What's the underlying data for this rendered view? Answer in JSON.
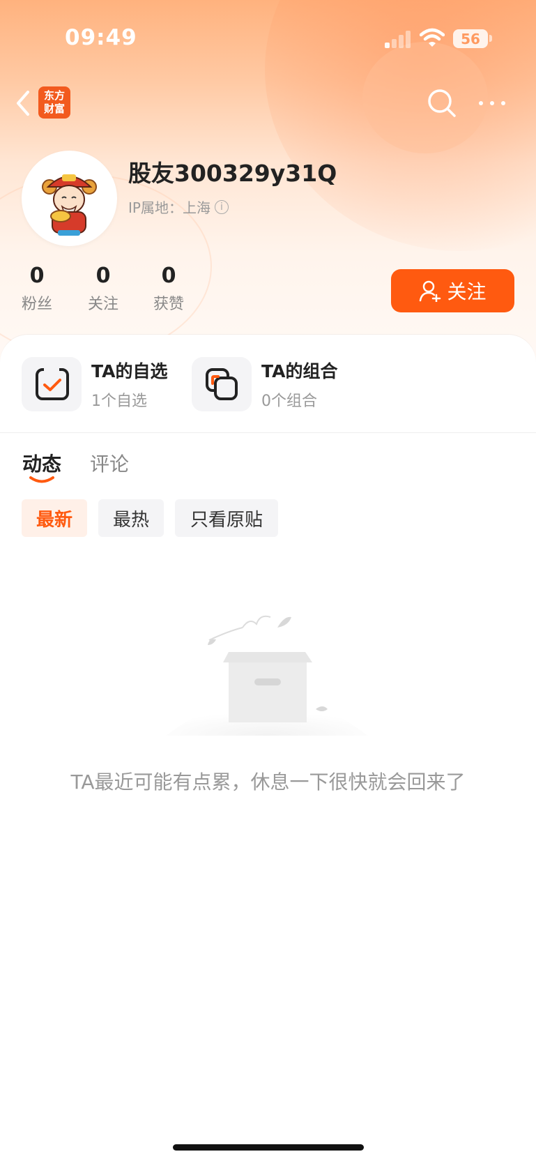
{
  "status_bar": {
    "time": "09:49",
    "battery": "56"
  },
  "nav": {
    "back_icon": "chevron-left-icon",
    "logo_text": "东方财富",
    "search_icon": "search-icon",
    "more_icon": "more-dots-icon"
  },
  "profile": {
    "username": "股友300329y31Q",
    "ip_location": "IP属地：上海",
    "info_icon": "info-icon",
    "stats": [
      {
        "value": "0",
        "label": "粉丝"
      },
      {
        "value": "0",
        "label": "关注"
      },
      {
        "value": "0",
        "label": "获赞"
      }
    ],
    "follow_label": "关注"
  },
  "quick_links": [
    {
      "title": "TA的自选",
      "subtitle": "1个自选",
      "icon": "watchlist-check-icon"
    },
    {
      "title": "TA的组合",
      "subtitle": "0个组合",
      "icon": "portfolio-icon"
    }
  ],
  "tabs": [
    {
      "label": "动态",
      "active": true
    },
    {
      "label": "评论",
      "active": false
    }
  ],
  "filters": [
    {
      "label": "最新",
      "active": true
    },
    {
      "label": "最热",
      "active": false
    },
    {
      "label": "只看原贴",
      "active": false
    }
  ],
  "empty_state": {
    "message": "TA最近可能有点累，休息一下很快就会回来了",
    "icon": "empty-box-icon"
  },
  "colors": {
    "accent": "#ff5a10",
    "accent_light": "#fff0e8"
  }
}
